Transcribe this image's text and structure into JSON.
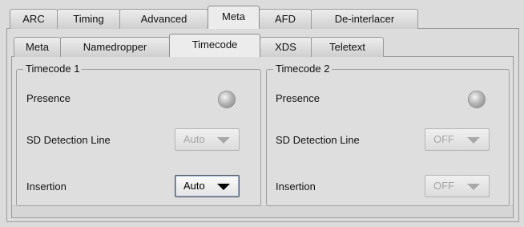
{
  "main_tabs": [
    "ARC",
    "Timing",
    "Advanced",
    "Meta",
    "AFD",
    "De-interlacer"
  ],
  "sub_tabs": [
    "Meta",
    "Namedropper",
    "Timecode",
    "XDS",
    "Teletext"
  ],
  "groups": [
    {
      "title": "Timecode 1",
      "presence_label": "Presence",
      "detection_label": "SD Detection Line",
      "detection_value": "Auto",
      "insertion_label": "Insertion",
      "insertion_value": "Auto"
    },
    {
      "title": "Timecode 2",
      "presence_label": "Presence",
      "detection_label": "SD Detection Line",
      "detection_value": "OFF",
      "insertion_label": "Insertion",
      "insertion_value": "OFF"
    }
  ],
  "colors": {
    "background": "#dcdcdc",
    "led_off": "#a9a9a9",
    "disabled_text": "#a5a5a5"
  }
}
